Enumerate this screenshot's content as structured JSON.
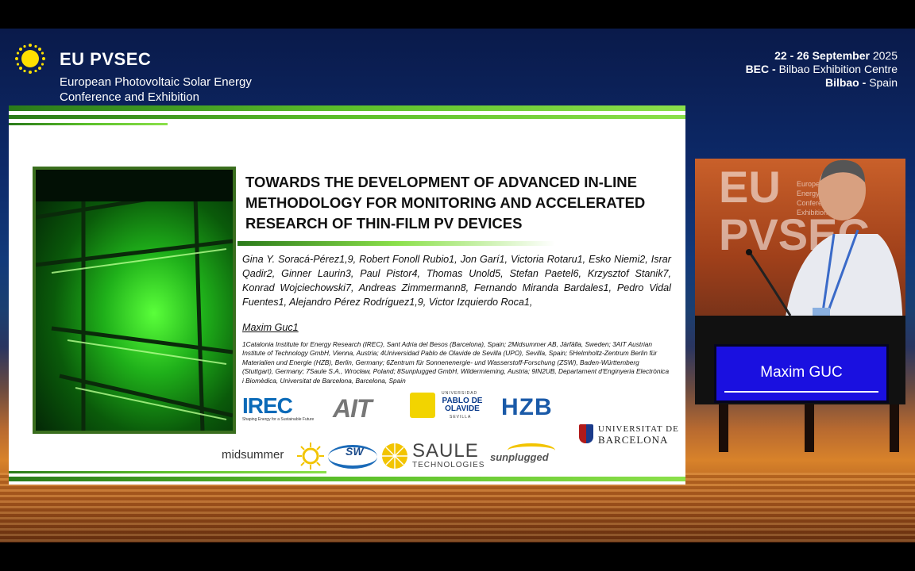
{
  "header": {
    "brand": "EU PVSEC",
    "subtitle": "European Photovoltaic Solar Energy Conference and Exhibition",
    "dates_bold": "22 - 26 September",
    "year": "2025",
    "venue_bold": "BEC -",
    "venue": "Bilbao Exhibition Centre",
    "city_bold": "Bilbao -",
    "country": "Spain"
  },
  "slide": {
    "title": "TOWARDS THE DEVELOPMENT OF ADVANCED IN-LINE METHODOLOGY FOR MONITORING AND ACCELERATED RESEARCH OF THIN-FILM PV DEVICES",
    "authors": "Gina Y. Soracá-Pérez1,9, Robert Fonoll Rubio1, Jon Garí1, Victoria Rotaru1, Esko Niemi2, Israr Qadir2, Ginner Laurin3, Paul Pistor4, Thomas Unold5, Stefan Paetel6, Krzysztof Stanik7, Konrad Wojciechowski7, Andreas Zimmermann8, Fernando Miranda Bardales1, Pedro Vidal Fuentes1, Alejandro Pérez Rodríguez1,9, Victor Izquierdo Roca1,",
    "presenter": "Maxim Guc1",
    "affiliations": "1Catalonia Institute for Energy Research (IREC), Sant Adria del Besos (Barcelona), Spain; 2Midsummer AB, Järfälla, Sweden; 3AIT Austrian Institute of Technology GmbH, Vienna, Austria; 4Universidad Pablo de Olavide de Sevilla (UPO), Sevilla, Spain; 5Helmholtz-Zentrum Berlin für Materialien und Energie (HZB), Berlin, Germany; 6Zentrum für Sonnenenergie- und Wasserstoff-Forschung (ZSW), Baden-Württemberg (Stuttgart), Germany; 7Saule S.A., Wrocław, Poland; 8Sunplugged GmbH, Wildermieming, Austria; 9IN2UB, Departament d'Enginyeria Electrònica i Biomèdica, Universitat de Barcelona, Barcelona, Spain",
    "logos": {
      "irec": "IREC",
      "irec_tag": "Shaping Energy for a Sustainable Future",
      "ait": "AIT",
      "upo_top": "UNIVERSIDAD",
      "upo_main": "PABLO DE OLAVIDE",
      "upo_bottom": "SEVILLA",
      "hzb": "HZB",
      "ub_1": "UNIVERSITAT DE",
      "ub_2": "BARCELONA",
      "midsummer": "midsummer",
      "zsw": "SW",
      "saule_1": "SAULE",
      "saule_2": "TECHNOLOGIES",
      "sunplugged": "sunplugged"
    }
  },
  "speaker": {
    "bg_letters_1": "EU",
    "bg_letters_2": "PVSEC",
    "bg_small": "European Energy Conference Exhibition",
    "name": "Maxim GUC"
  },
  "colors": {
    "green": "#5cc02a",
    "dark_green": "#2a7a1a",
    "blue_screen": "#1a10e0"
  }
}
